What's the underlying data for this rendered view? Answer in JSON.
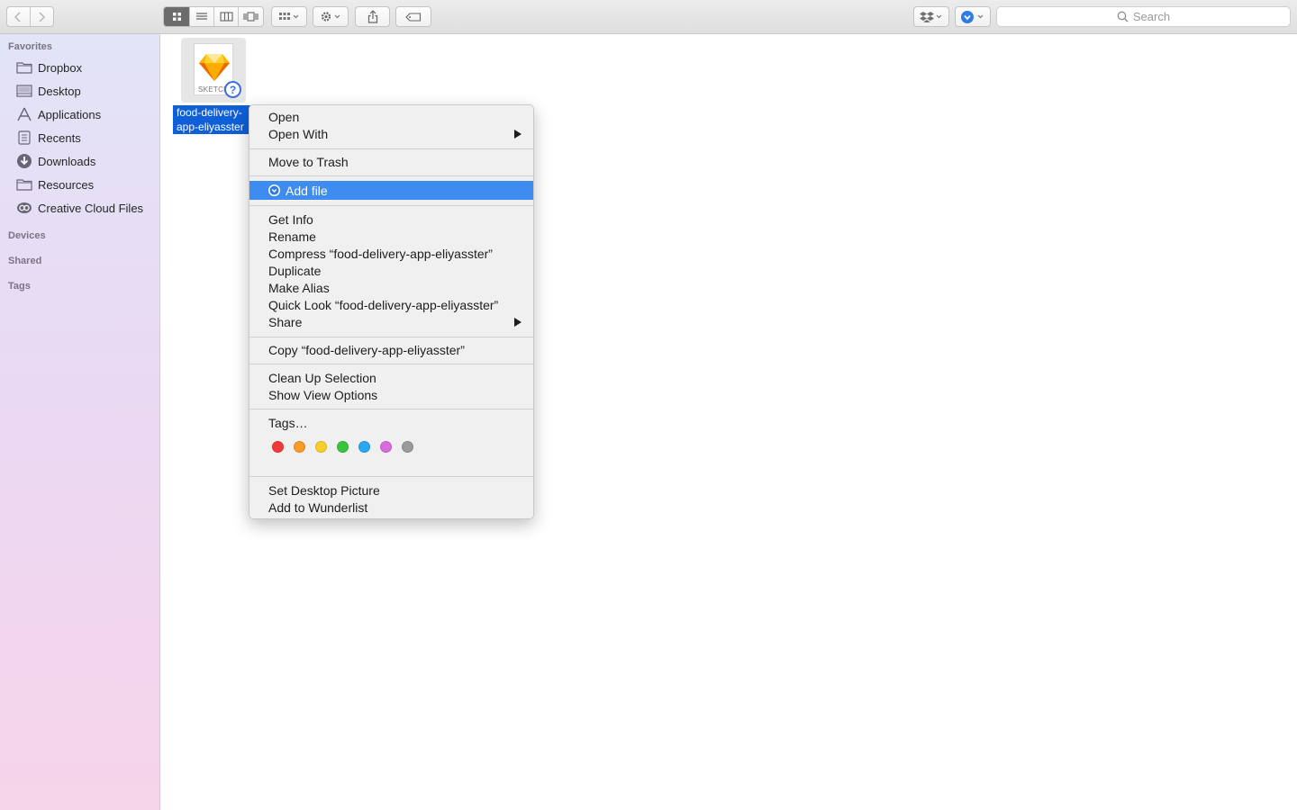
{
  "toolbar": {
    "search_placeholder": "Search"
  },
  "sidebar": {
    "sections": {
      "favorites": "Favorites",
      "devices": "Devices",
      "shared": "Shared",
      "tags": "Tags"
    },
    "items": [
      {
        "label": "Dropbox",
        "icon": "folder-icon"
      },
      {
        "label": "Desktop",
        "icon": "desktop-icon"
      },
      {
        "label": "Applications",
        "icon": "applications-icon"
      },
      {
        "label": "Recents",
        "icon": "recents-icon"
      },
      {
        "label": "Downloads",
        "icon": "downloads-icon"
      },
      {
        "label": "Resources",
        "icon": "folder-icon"
      },
      {
        "label": "Creative Cloud Files",
        "icon": "creative-cloud-icon"
      }
    ]
  },
  "file": {
    "name_line1": "food-delivery-",
    "name_line2": "app-eliyasster",
    "type_label": "SKETCH"
  },
  "context_menu": {
    "open": "Open",
    "open_with": "Open With",
    "move_to_trash": "Move to Trash",
    "add_file": "Add file",
    "get_info": "Get Info",
    "rename": "Rename",
    "compress": "Compress “food-delivery-app-eliyasster”",
    "duplicate": "Duplicate",
    "make_alias": "Make Alias",
    "quick_look": "Quick Look “food-delivery-app-eliyasster”",
    "share": "Share",
    "copy": "Copy “food-delivery-app-eliyasster”",
    "clean_up": "Clean Up Selection",
    "show_view_options": "Show View Options",
    "tags": "Tags…",
    "tag_colors": [
      "#f03a3a",
      "#f99a2a",
      "#f6cf2c",
      "#3ac43e",
      "#2ba7ef",
      "#d66ddb",
      "#9a9a9a"
    ],
    "set_desktop_picture": "Set Desktop Picture",
    "add_to_wunderlist": "Add to Wunderlist"
  },
  "colors": {
    "selection_blue": "#0f5fd8",
    "menu_highlight": "#3f8cf0"
  }
}
